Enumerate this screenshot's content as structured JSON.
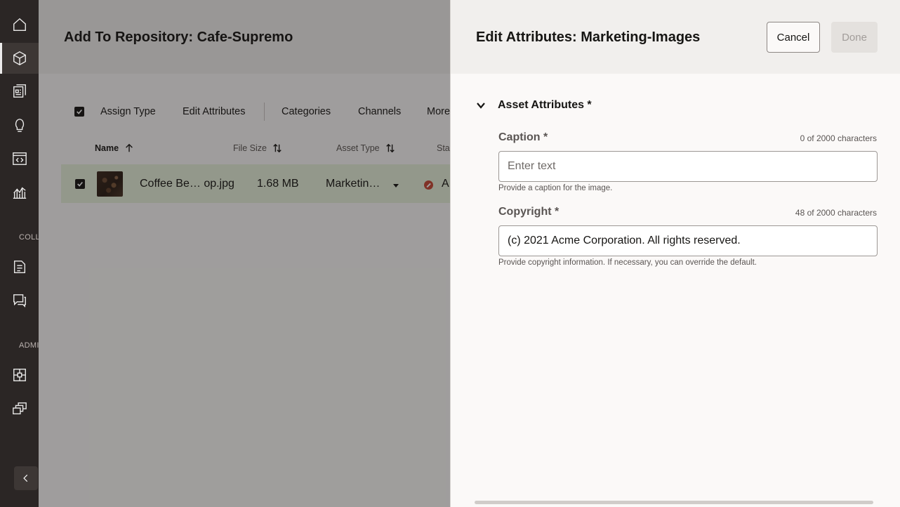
{
  "nav_rail": {
    "items": [
      {
        "icon": "home-icon"
      },
      {
        "icon": "cube-icon",
        "active": true
      },
      {
        "icon": "documents-icon"
      },
      {
        "icon": "lightbulb-icon"
      },
      {
        "icon": "code-page-icon"
      },
      {
        "icon": "analytics-icon"
      },
      {
        "icon": "collection-doc-icon"
      },
      {
        "icon": "conversation-icon"
      },
      {
        "icon": "integration-icon"
      },
      {
        "icon": "layers-icon"
      }
    ],
    "section_collections": "COLL",
    "section_admin": "ADMI",
    "collapse_icon": "chevron-left-icon"
  },
  "main": {
    "title": "Add To Repository: Cafe-Supremo",
    "toolbar": {
      "assign_type": "Assign Type",
      "edit_attributes": "Edit Attributes",
      "categories": "Categories",
      "channels": "Channels",
      "more": "More"
    },
    "columns": {
      "name": "Name",
      "file_size": "File Size",
      "asset_type": "Asset Type",
      "status": "Sta"
    },
    "rows": [
      {
        "name": "Coffee Be… op.jpg",
        "file_size": "1.68 MB",
        "asset_type": "Marketin…",
        "status": "A",
        "status_color": "#c74634",
        "selected": true
      }
    ],
    "row_highlight_color": "#e7f0da"
  },
  "drawer": {
    "title": "Edit Attributes: Marketing-Images",
    "cancel_label": "Cancel",
    "done_label": "Done",
    "section_title": "Asset Attributes *",
    "fields": {
      "caption": {
        "label": "Caption *",
        "count": "0 of 2000 characters",
        "placeholder": "Enter text",
        "value": "",
        "help": "Provide a caption for the image."
      },
      "copyright": {
        "label": "Copyright *",
        "count": "48 of 2000 characters",
        "value": "(c) 2021  Acme Corporation. All rights reserved.",
        "help": "Provide copyright information. If necessary, you can override the default."
      }
    }
  }
}
